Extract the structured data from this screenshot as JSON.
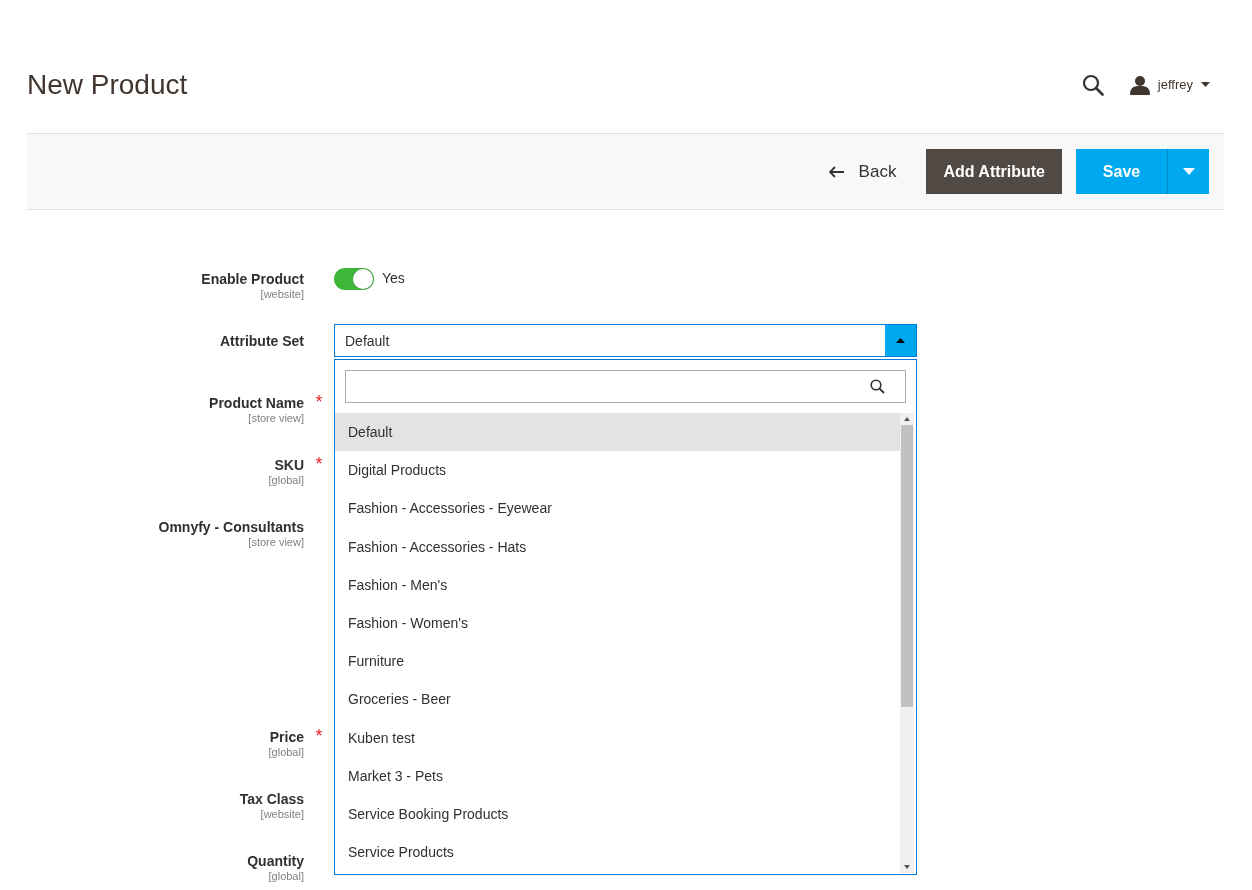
{
  "header": {
    "title": "New Product",
    "user": "jeffrey"
  },
  "toolbar": {
    "back": "Back",
    "add_attribute": "Add Attribute",
    "save": "Save"
  },
  "fields": [
    {
      "label": "Enable Product",
      "scope": "[website]",
      "kind": "toggle",
      "on": true,
      "value": "Yes"
    },
    {
      "label": "Attribute Set",
      "kind": "select",
      "value": "Default",
      "expanded": true
    },
    {
      "label": "Product Name",
      "scope": "[store view]",
      "required_mark": "*",
      "kind": "text"
    },
    {
      "label": "SKU",
      "scope": "[global]",
      "required_mark": "*",
      "kind": "text"
    },
    {
      "label": "Omnyfy - Consultants",
      "scope": "[store view]",
      "kind": "multiline"
    },
    {
      "label": "Price",
      "scope": "[global]",
      "required_mark": "*",
      "kind": "text"
    },
    {
      "label": "Tax Class",
      "scope": "[website]",
      "kind": "text"
    },
    {
      "label": "Quantity",
      "scope": "[global]",
      "kind": "text"
    }
  ],
  "attribute_set_options": [
    {
      "label": "Default",
      "selected": true
    },
    {
      "label": "Digital Products",
      "selected": false
    },
    {
      "label": "Fashion - Accessories - Eyewear",
      "selected": false
    },
    {
      "label": "Fashion - Accessories - Hats",
      "selected": false
    },
    {
      "label": "Fashion - Men's",
      "selected": false
    },
    {
      "label": "Fashion - Women's",
      "selected": false
    },
    {
      "label": "Furniture",
      "selected": false
    },
    {
      "label": "Groceries - Beer",
      "selected": false
    },
    {
      "label": "Kuben test",
      "selected": false
    },
    {
      "label": "Market 3 - Pets",
      "selected": false
    },
    {
      "label": "Service Booking Products",
      "selected": false
    },
    {
      "label": "Service Products",
      "selected": false
    }
  ]
}
